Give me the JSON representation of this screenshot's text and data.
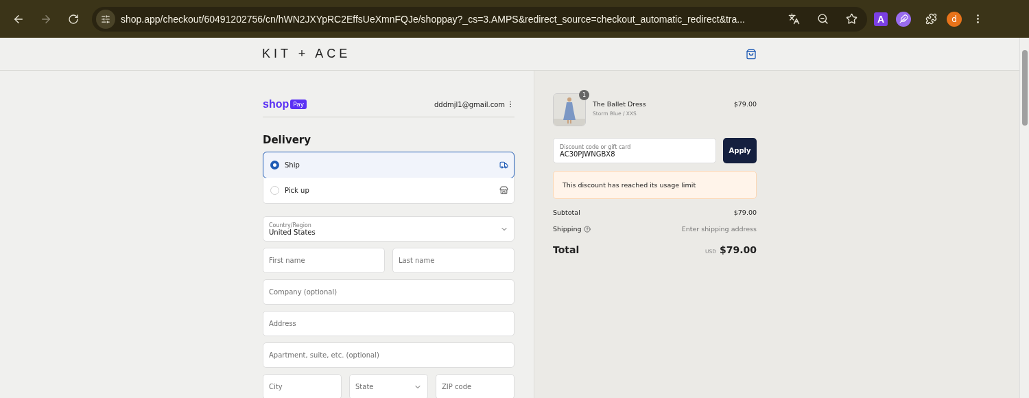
{
  "browser": {
    "url": "shop.app/checkout/60491202756/cn/hWN2JXYpRC2EffsUeXmnFQJe/shoppay?_cs=3.AMPS&redirect_source=checkout_automatic_redirect&tra...",
    "extension_letter": "A",
    "profile_initial": "d"
  },
  "header": {
    "brand": "KIT + ACE"
  },
  "account": {
    "logo_word": "shop",
    "logo_badge": "Pay",
    "email": "dddmjl1@gmail.com"
  },
  "delivery": {
    "title": "Delivery",
    "options": [
      {
        "label": "Ship",
        "kind": "ship",
        "selected": true
      },
      {
        "label": "Pick up",
        "kind": "pickup",
        "selected": false
      }
    ]
  },
  "form_rows": [
    [
      {
        "kind": "select",
        "label": "Country/Region",
        "value": "United States"
      }
    ],
    [
      {
        "kind": "text",
        "placeholder": "First name"
      },
      {
        "kind": "text",
        "placeholder": "Last name"
      }
    ],
    [
      {
        "kind": "text",
        "placeholder": "Company (optional)"
      }
    ],
    [
      {
        "kind": "text",
        "placeholder": "Address"
      }
    ],
    [
      {
        "kind": "text",
        "placeholder": "Apartment, suite, etc. (optional)"
      }
    ],
    [
      {
        "kind": "text",
        "placeholder": "City"
      },
      {
        "kind": "select",
        "placeholder": "State"
      },
      {
        "kind": "text",
        "placeholder": "ZIP code"
      }
    ]
  ],
  "order": {
    "item": {
      "name": "The Ballet Dress",
      "variant": "Storm Blue / XXS",
      "price": "$79.00",
      "quantity": "1"
    },
    "discount": {
      "label": "Discount code or gift card",
      "value": "AC30PJWNGBX8",
      "button": "Apply"
    },
    "notice": "This discount has reached its usage limit",
    "subtotal": {
      "label": "Subtotal",
      "value": "$79.00"
    },
    "shipping": {
      "label": "Shipping",
      "value": "Enter shipping address"
    },
    "total": {
      "label": "Total",
      "currency": "USD",
      "value": "$79.00"
    }
  }
}
